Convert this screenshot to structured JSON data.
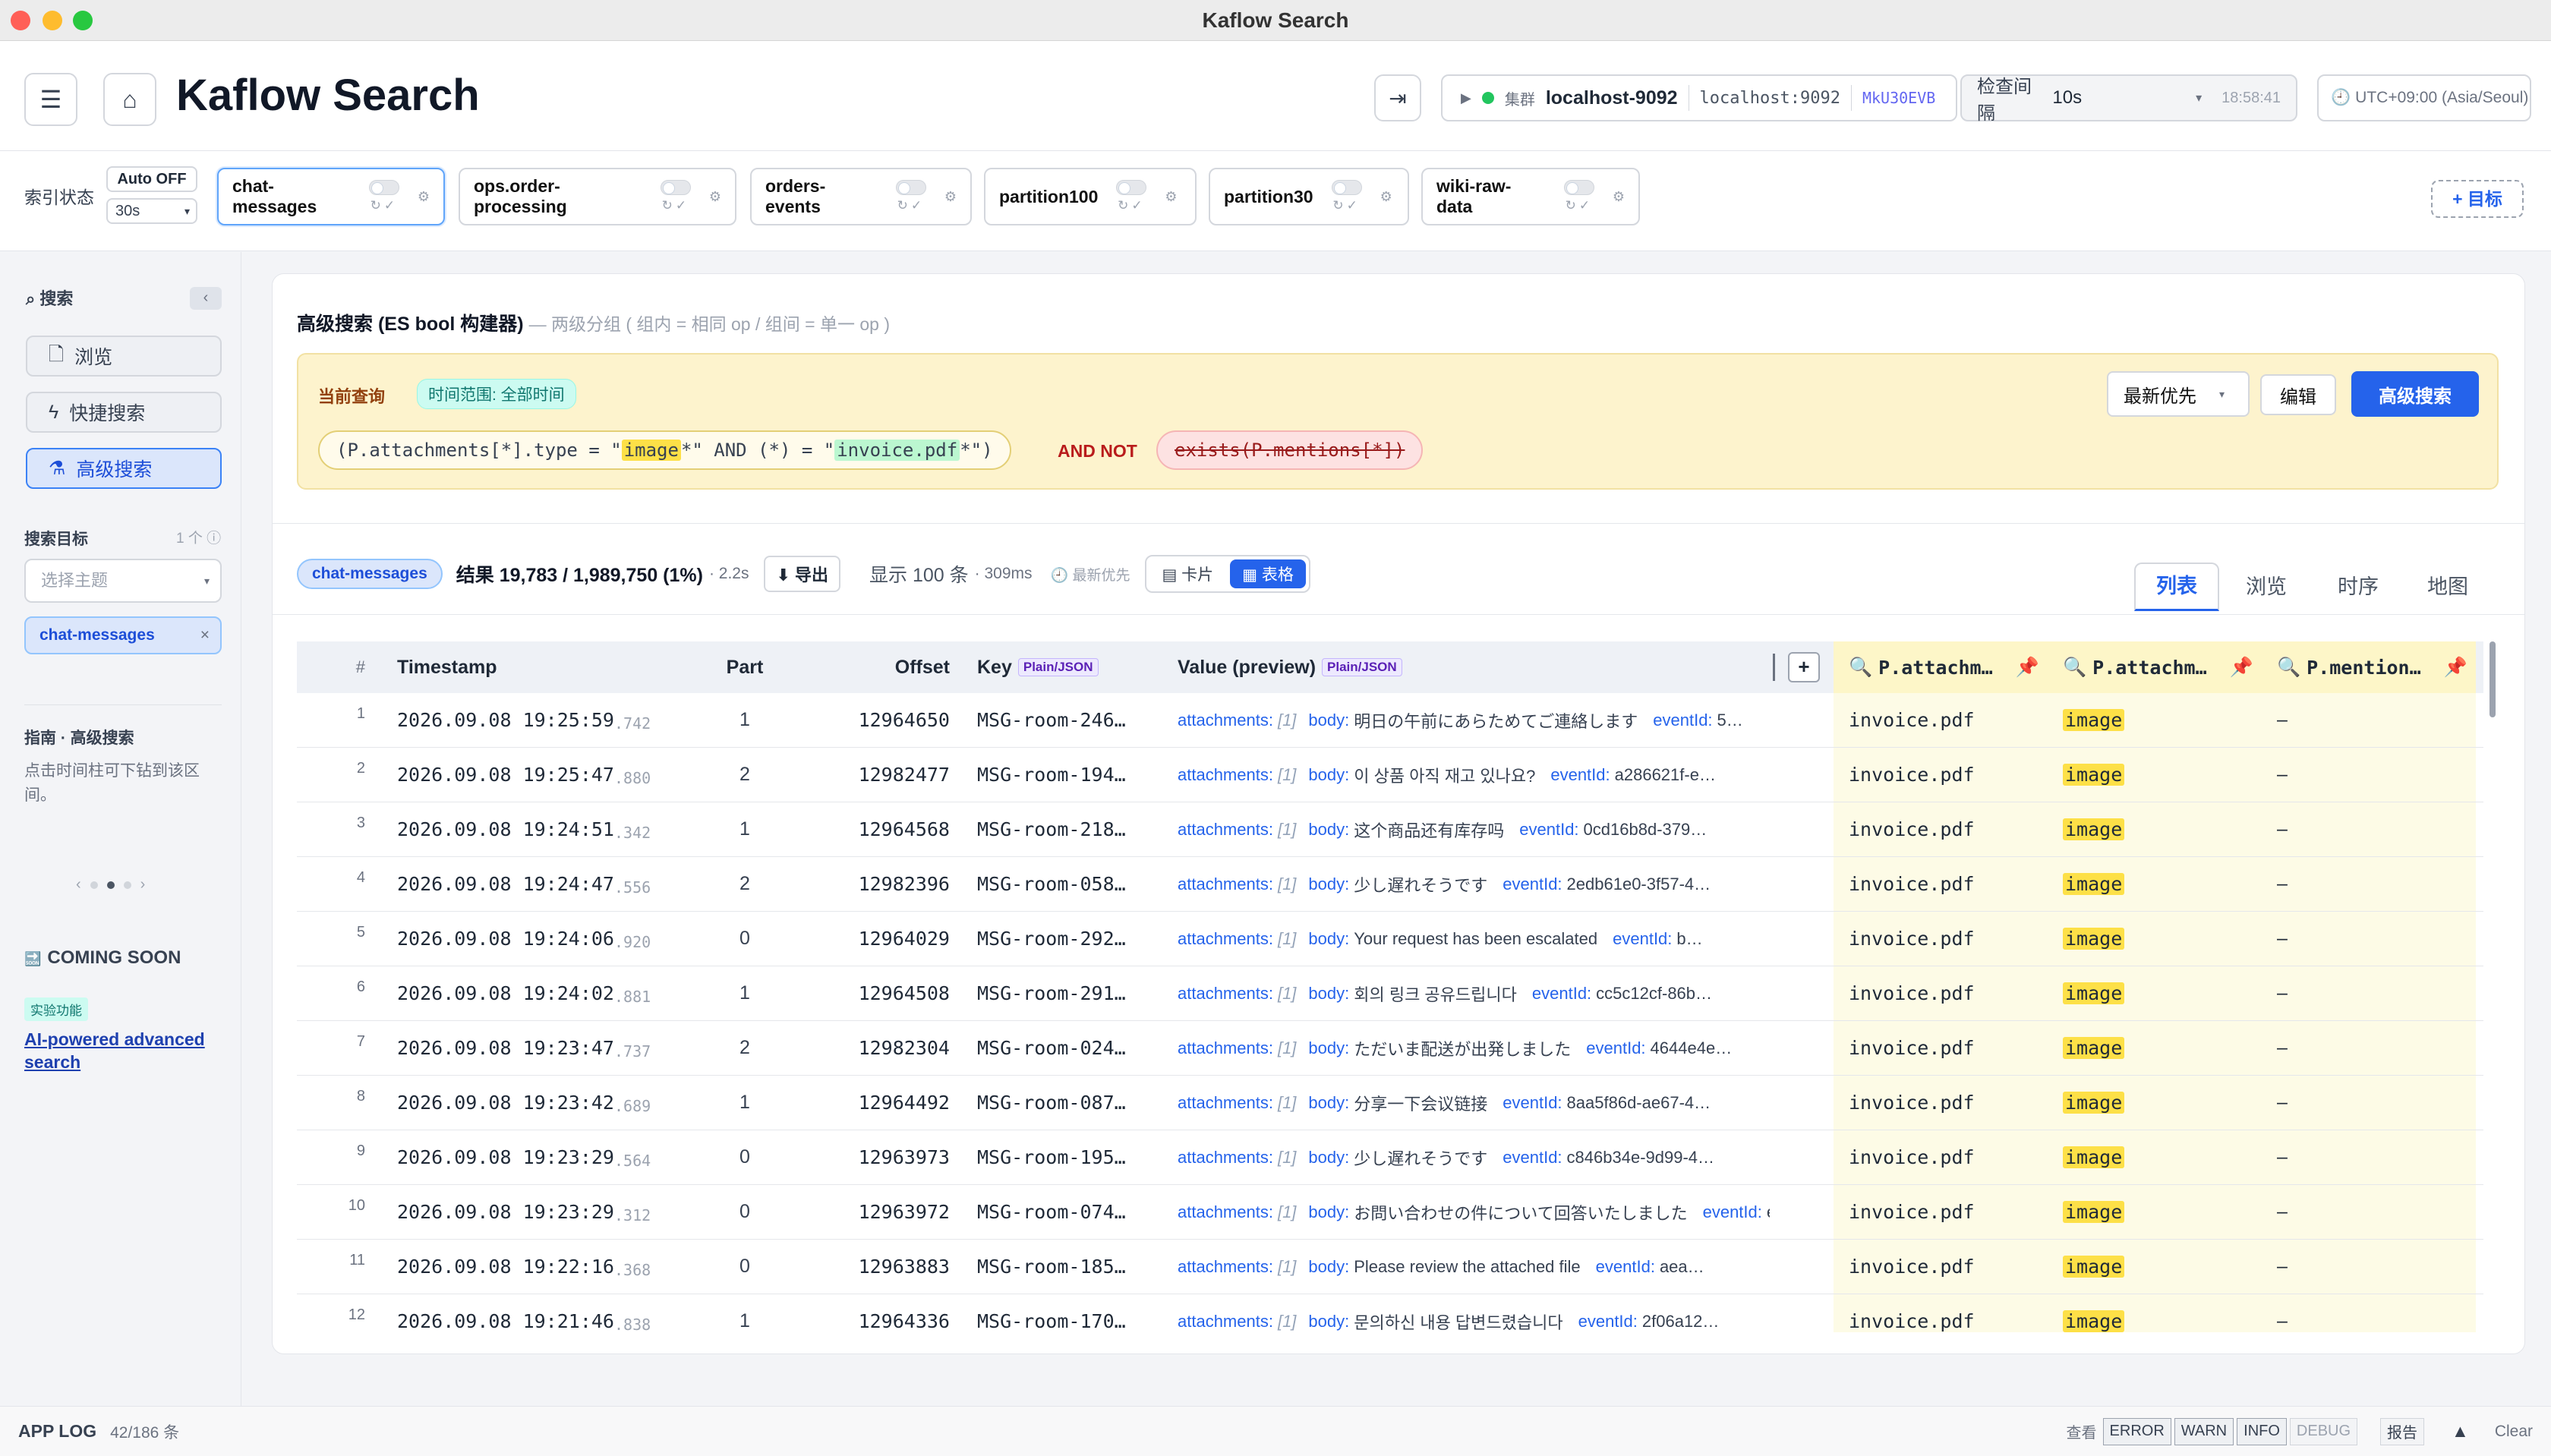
{
  "window": {
    "title": "Kaflow Search"
  },
  "header": {
    "app_title": "Kaflow Search",
    "cluster_label": "集群",
    "cluster_name": "localhost-9092",
    "cluster_host": "localhost:9092",
    "cluster_id": "MkU30EVB",
    "interval_label": "检查间隔",
    "interval_value": "10s",
    "last_check": "18:58:41",
    "timezone": "UTC+09:00 (Asia/Seoul)"
  },
  "index_bar": {
    "label": "索引状态",
    "auto_label": "Auto OFF",
    "auto_interval": "30s",
    "topics": [
      "chat-messages",
      "ops.order-processing",
      "orders-events",
      "partition100",
      "partition30",
      "wiki-raw-data"
    ],
    "active_topic": "chat-messages",
    "add_target": "+ 目标"
  },
  "sidebar": {
    "search_label": "搜索",
    "collapse": "‹",
    "nav": [
      "浏览",
      "快捷搜索",
      "高级搜索"
    ],
    "active_nav": "高级搜索",
    "target_label": "搜索目标",
    "target_count": "1 个",
    "topic_select_placeholder": "选择主题",
    "selected_topic": "chat-messages",
    "guide_title": "指南 · 高级搜索",
    "guide_text": "点击时间柱可下钻到该区间。",
    "pager_prev": "‹",
    "pager_next": "›",
    "coming_soon": "COMING SOON",
    "experimental": "实验功能",
    "ai_link": "AI-powered advanced search"
  },
  "advanced": {
    "title": "高级搜索 (ES bool 构建器)",
    "subtitle": "— 两级分组 ( 组内 = 相同 op / 组间 = 单一 op )",
    "current_query": "当前查询",
    "time_range": "时间范围: 全部时间",
    "clause1_pre": "(P.attachments[*].type = \"",
    "clause1_v1": "image",
    "clause1_mid": "*\" AND (*) = \"",
    "clause1_v2": "invoice.pdf",
    "clause1_post": "*\")",
    "and_not": "AND NOT",
    "clause2": "exists(P.mentions[*])",
    "sort_value": "最新优先",
    "edit_btn": "编辑",
    "search_btn": "高级搜索"
  },
  "results": {
    "topic_chip": "chat-messages",
    "summary": "结果 19,783 / 1,989,750 (1%)",
    "took": "· 2.2s",
    "export_btn": "⬇ 导出",
    "shown": "显示 100 条",
    "shown_ms": "· 309ms",
    "latest_first": "最新优先",
    "view_card": "卡片",
    "view_table": "表格",
    "tabs": [
      "列表",
      "浏览",
      "时序",
      "地图"
    ],
    "active_tab": "列表"
  },
  "table": {
    "headers": {
      "idx": "#",
      "ts": "Timestamp",
      "part": "Part",
      "offset": "Offset",
      "key": "Key",
      "value": "Value (preview)",
      "fmt": "Plain/JSON",
      "c1": "P.attachm…",
      "c2": "P.attachm…",
      "c3": "P.mention…",
      "add": "+"
    },
    "rows": [
      {
        "n": "1",
        "ts": "2026.09.08 19:25:59",
        "ms": ".742",
        "part": "1",
        "offset": "12964650",
        "key": "MSG-room-246…",
        "body": "明日の午前にあらためてご連絡します",
        "eid": "5…",
        "c1": "invoice.pdf",
        "c2": "image",
        "c3": "–"
      },
      {
        "n": "2",
        "ts": "2026.09.08 19:25:47",
        "ms": ".880",
        "part": "2",
        "offset": "12982477",
        "key": "MSG-room-194…",
        "body": "이 상품 아직 재고 있나요?",
        "eid": "a286621f-e…",
        "c1": "invoice.pdf",
        "c2": "image",
        "c3": "–"
      },
      {
        "n": "3",
        "ts": "2026.09.08 19:24:51",
        "ms": ".342",
        "part": "1",
        "offset": "12964568",
        "key": "MSG-room-218…",
        "body": "这个商品还有库存吗",
        "eid": "0cd16b8d-379…",
        "c1": "invoice.pdf",
        "c2": "image",
        "c3": "–"
      },
      {
        "n": "4",
        "ts": "2026.09.08 19:24:47",
        "ms": ".556",
        "part": "2",
        "offset": "12982396",
        "key": "MSG-room-058…",
        "body": "少し遅れそうです",
        "eid": "2edb61e0-3f57-4…",
        "c1": "invoice.pdf",
        "c2": "image",
        "c3": "–"
      },
      {
        "n": "5",
        "ts": "2026.09.08 19:24:06",
        "ms": ".920",
        "part": "0",
        "offset": "12964029",
        "key": "MSG-room-292…",
        "body": "Your request has been escalated",
        "eid": "b…",
        "c1": "invoice.pdf",
        "c2": "image",
        "c3": "–"
      },
      {
        "n": "6",
        "ts": "2026.09.08 19:24:02",
        "ms": ".881",
        "part": "1",
        "offset": "12964508",
        "key": "MSG-room-291…",
        "body": "회의 링크 공유드립니다",
        "eid": "cc5c12cf-86b…",
        "c1": "invoice.pdf",
        "c2": "image",
        "c3": "–"
      },
      {
        "n": "7",
        "ts": "2026.09.08 19:23:47",
        "ms": ".737",
        "part": "2",
        "offset": "12982304",
        "key": "MSG-room-024…",
        "body": "ただいま配送が出発しました",
        "eid": "4644e4e…",
        "c1": "invoice.pdf",
        "c2": "image",
        "c3": "–"
      },
      {
        "n": "8",
        "ts": "2026.09.08 19:23:42",
        "ms": ".689",
        "part": "1",
        "offset": "12964492",
        "key": "MSG-room-087…",
        "body": "分享一下会议链接",
        "eid": "8aa5f86d-ae67-4…",
        "c1": "invoice.pdf",
        "c2": "image",
        "c3": "–"
      },
      {
        "n": "9",
        "ts": "2026.09.08 19:23:29",
        "ms": ".564",
        "part": "0",
        "offset": "12963973",
        "key": "MSG-room-195…",
        "body": "少し遅れそうです",
        "eid": "c846b34e-9d99-4…",
        "c1": "invoice.pdf",
        "c2": "image",
        "c3": "–"
      },
      {
        "n": "10",
        "ts": "2026.09.08 19:23:29",
        "ms": ".312",
        "part": "0",
        "offset": "12963972",
        "key": "MSG-room-074…",
        "body": "お問い合わせの件について回答いたしました",
        "eid": "eve…",
        "c1": "invoice.pdf",
        "c2": "image",
        "c3": "–"
      },
      {
        "n": "11",
        "ts": "2026.09.08 19:22:16",
        "ms": ".368",
        "part": "0",
        "offset": "12963883",
        "key": "MSG-room-185…",
        "body": "Please review the attached file",
        "eid": "aea…",
        "c1": "invoice.pdf",
        "c2": "image",
        "c3": "–"
      },
      {
        "n": "12",
        "ts": "2026.09.08 19:21:46",
        "ms": ".838",
        "part": "1",
        "offset": "12964336",
        "key": "MSG-room-170…",
        "body": "문의하신 내용 답변드렸습니다",
        "eid": "2f06a12…",
        "c1": "invoice.pdf",
        "c2": "image",
        "c3": "–"
      }
    ],
    "value_keys": {
      "attachments": "attachments:",
      "att_count": "[1]",
      "body": "body:",
      "event": "eventId:"
    }
  },
  "applog": {
    "label": "APP LOG",
    "count": "42/186 条",
    "view": "查看",
    "levels": [
      "ERROR",
      "WARN",
      "INFO",
      "DEBUG"
    ],
    "report": "报告",
    "clear": "Clear"
  },
  "colors": {
    "accent": "#2563eb",
    "highlight": "#fde047",
    "query_bg": "#fdf3cd",
    "not_clause": "#fde2e2"
  }
}
